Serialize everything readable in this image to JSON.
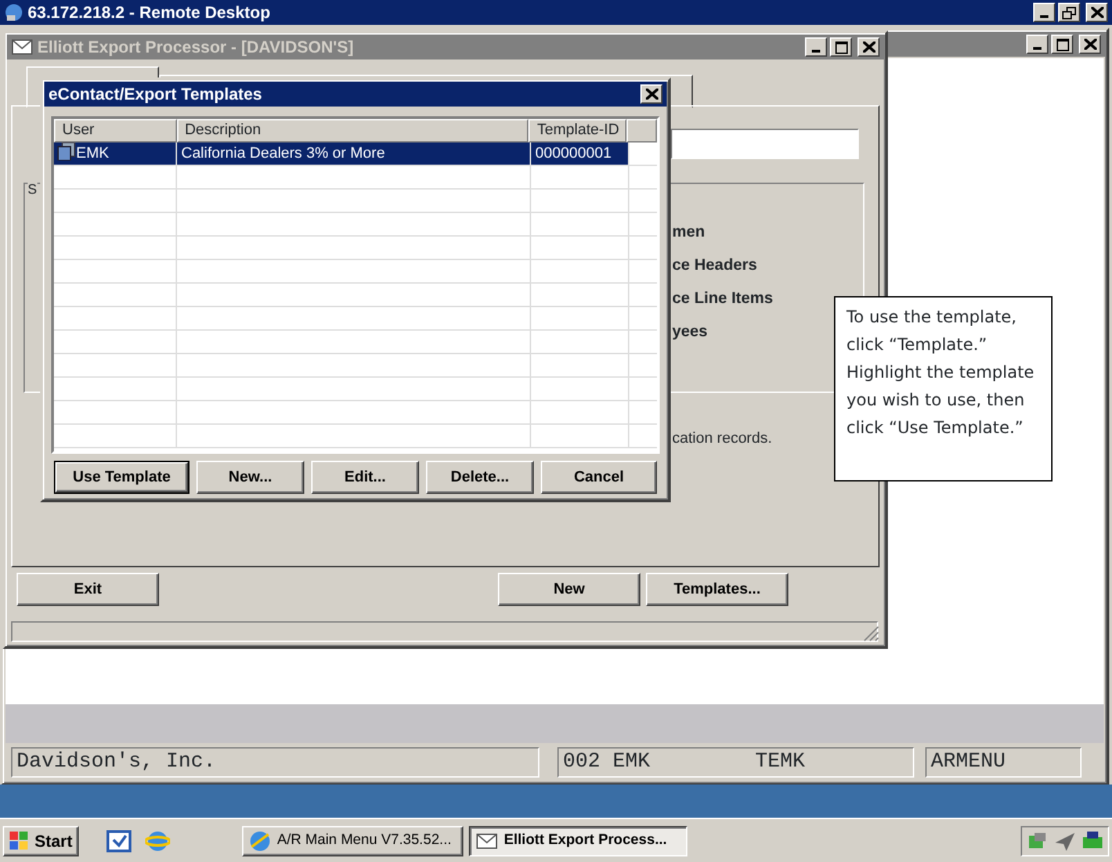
{
  "remote_desktop": {
    "title": "63.172.218.2 - Remote Desktop"
  },
  "export_window": {
    "title": "Elliott Export Processor - [DAVIDSON'S]",
    "group_label": "S",
    "options": [
      "men",
      "ce Headers",
      "ce Line Items",
      "yees"
    ],
    "note": "cation records.",
    "buttons": [
      {
        "label": "Exit"
      },
      {
        "label": "New"
      },
      {
        "label": "Templates..."
      }
    ]
  },
  "dialog": {
    "title": "eContact/Export Templates",
    "columns": [
      "User",
      "Description",
      "Template-ID"
    ],
    "rows": [
      {
        "user": "EMK",
        "description": "California Dealers 3% or More",
        "template_id": "000000001",
        "selected": true
      }
    ],
    "buttons": [
      {
        "label": "Use Template",
        "default": true
      },
      {
        "label": "New...",
        "default": false
      },
      {
        "label": "Edit...",
        "default": false
      },
      {
        "label": "Delete...",
        "default": false
      },
      {
        "label": "Cancel",
        "default": false
      }
    ]
  },
  "callout": {
    "lines": [
      "To use the template,",
      "click “Template.”",
      "Highlight the template",
      "you wish to use, then",
      "click “Use Template.”"
    ]
  },
  "status_bar": {
    "company": "Davidson's, Inc.",
    "user": "002 EMK",
    "terminal": "TEMK",
    "menu": "ARMENU"
  },
  "taskbar": {
    "start": "Start",
    "tasks": [
      {
        "label": "A/R Main Menu V7.35.52...",
        "selected": false
      },
      {
        "label": "Elliott Export Process...",
        "selected": true
      }
    ]
  }
}
